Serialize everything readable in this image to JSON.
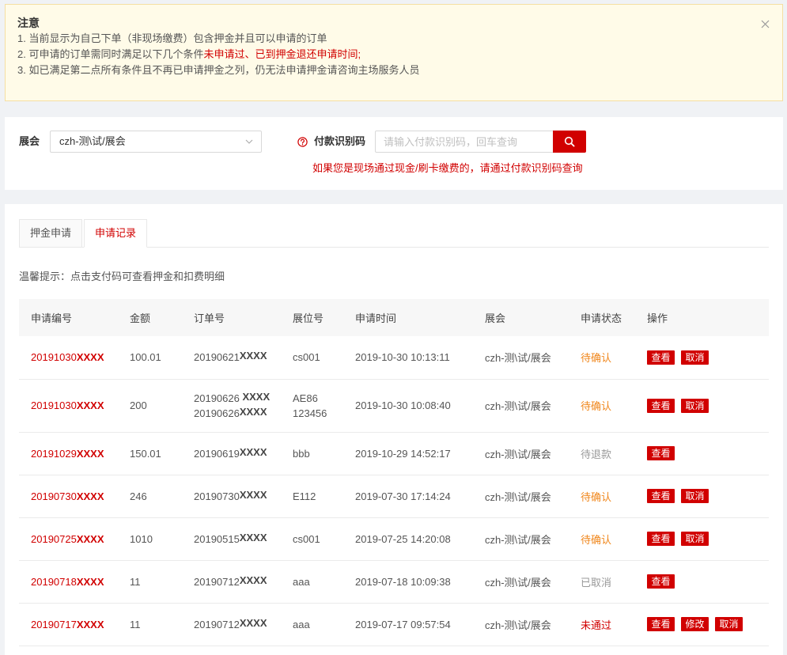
{
  "notice": {
    "title": "注意",
    "close_icon": "close-icon",
    "lines": [
      {
        "text": "1. 当前显示为自己下单（非现场缴费）包含押金并且可以申请的订单"
      },
      {
        "text": "2. 可申请的订单需同时满足以下几个条件",
        "highlight": "未申请过、已到押金退还申请时间;"
      },
      {
        "text": "3. 如已满足第二点所有条件且不再已申请押金之列，仍无法申请押金请咨询主场服务人员"
      }
    ]
  },
  "filter": {
    "expo": {
      "label": "展会",
      "value": "czh-测\\试/展会",
      "icon": "chevron-down-icon"
    },
    "pay_code": {
      "help_icon": "question-circle-icon",
      "label": "付款识别码",
      "placeholder": "请输入付款识别码，回车查询",
      "search_icon": "search-icon"
    },
    "hint": "如果您是现场通过现金/刷卡缴费的，请通过付款识别码查询"
  },
  "tabs": [
    {
      "label": "押金申请",
      "active": false
    },
    {
      "label": "申请记录",
      "active": true
    }
  ],
  "tip": "温馨提示：点击支付码可查看押金和扣费明细",
  "table": {
    "headers": [
      "申请编号",
      "金额",
      "订单号",
      "展位号",
      "申请时间",
      "展会",
      "申请状态",
      "操作"
    ],
    "rows": [
      {
        "id": {
          "prefix": "20191030",
          "mask": "XXXX"
        },
        "amount": "100.01",
        "orders": [
          {
            "prefix": "20190621",
            "mask": "XXXX"
          }
        ],
        "booths": [
          "cs001"
        ],
        "time": "2019-10-30 10:13:11",
        "expo": "czh-测\\试/展会",
        "status": {
          "text": "待确认",
          "color": "#f0861b"
        },
        "actions": [
          "查看",
          "取消"
        ]
      },
      {
        "id": {
          "prefix": "20191030",
          "mask": "XXXX"
        },
        "amount": "200",
        "orders": [
          {
            "prefix": "20190626 ",
            "mask": "XXXX"
          },
          {
            "prefix": "20190626",
            "mask": "XXXX"
          }
        ],
        "booths": [
          "AE86",
          "123456"
        ],
        "time": "2019-10-30 10:08:40",
        "expo": "czh-测\\试/展会",
        "status": {
          "text": "待确认",
          "color": "#f0861b"
        },
        "actions": [
          "查看",
          "取消"
        ]
      },
      {
        "id": {
          "prefix": "20191029",
          "mask": "XXXX"
        },
        "amount": "150.01",
        "orders": [
          {
            "prefix": "20190619",
            "mask": "XXXX"
          }
        ],
        "booths": [
          "bbb"
        ],
        "time": "2019-10-29 14:52:17",
        "expo": "czh-测\\试/展会",
        "status": {
          "text": "待退款",
          "color": "#999999"
        },
        "actions": [
          "查看"
        ]
      },
      {
        "id": {
          "prefix": "20190730",
          "mask": "XXXX"
        },
        "amount": "246",
        "orders": [
          {
            "prefix": "20190730",
            "mask": "XXXX"
          }
        ],
        "booths": [
          "E112"
        ],
        "time": "2019-07-30 17:14:24",
        "expo": "czh-测\\试/展会",
        "status": {
          "text": "待确认",
          "color": "#f0861b"
        },
        "actions": [
          "查看",
          "取消"
        ]
      },
      {
        "id": {
          "prefix": "20190725",
          "mask": "XXXX"
        },
        "amount": "1010",
        "orders": [
          {
            "prefix": "20190515",
            "mask": "XXXX"
          }
        ],
        "booths": [
          "cs001"
        ],
        "time": "2019-07-25 14:20:08",
        "expo": "czh-测\\试/展会",
        "status": {
          "text": "待确认",
          "color": "#f0861b"
        },
        "actions": [
          "查看",
          "取消"
        ]
      },
      {
        "id": {
          "prefix": "20190718",
          "mask": "XXXX"
        },
        "amount": "11",
        "orders": [
          {
            "prefix": "20190712",
            "mask": "XXXX"
          }
        ],
        "booths": [
          "aaa"
        ],
        "time": "2019-07-18 10:09:38",
        "expo": "czh-测\\试/展会",
        "status": {
          "text": "已取消",
          "color": "#999999"
        },
        "actions": [
          "查看"
        ]
      },
      {
        "id": {
          "prefix": "20190717",
          "mask": "XXXX"
        },
        "amount": "11",
        "orders": [
          {
            "prefix": "20190712",
            "mask": "XXXX"
          }
        ],
        "booths": [
          "aaa"
        ],
        "time": "2019-07-17 09:57:54",
        "expo": "czh-测\\试/展会",
        "status": {
          "text": "未通过",
          "color": "#d10000"
        },
        "actions": [
          "查看",
          "修改",
          "取消"
        ]
      }
    ]
  },
  "colors": {
    "accent": "#d10000",
    "notice_bg": "#fffbe8",
    "notice_border": "#f5dfa2",
    "page_bg": "#f0f2f5"
  }
}
